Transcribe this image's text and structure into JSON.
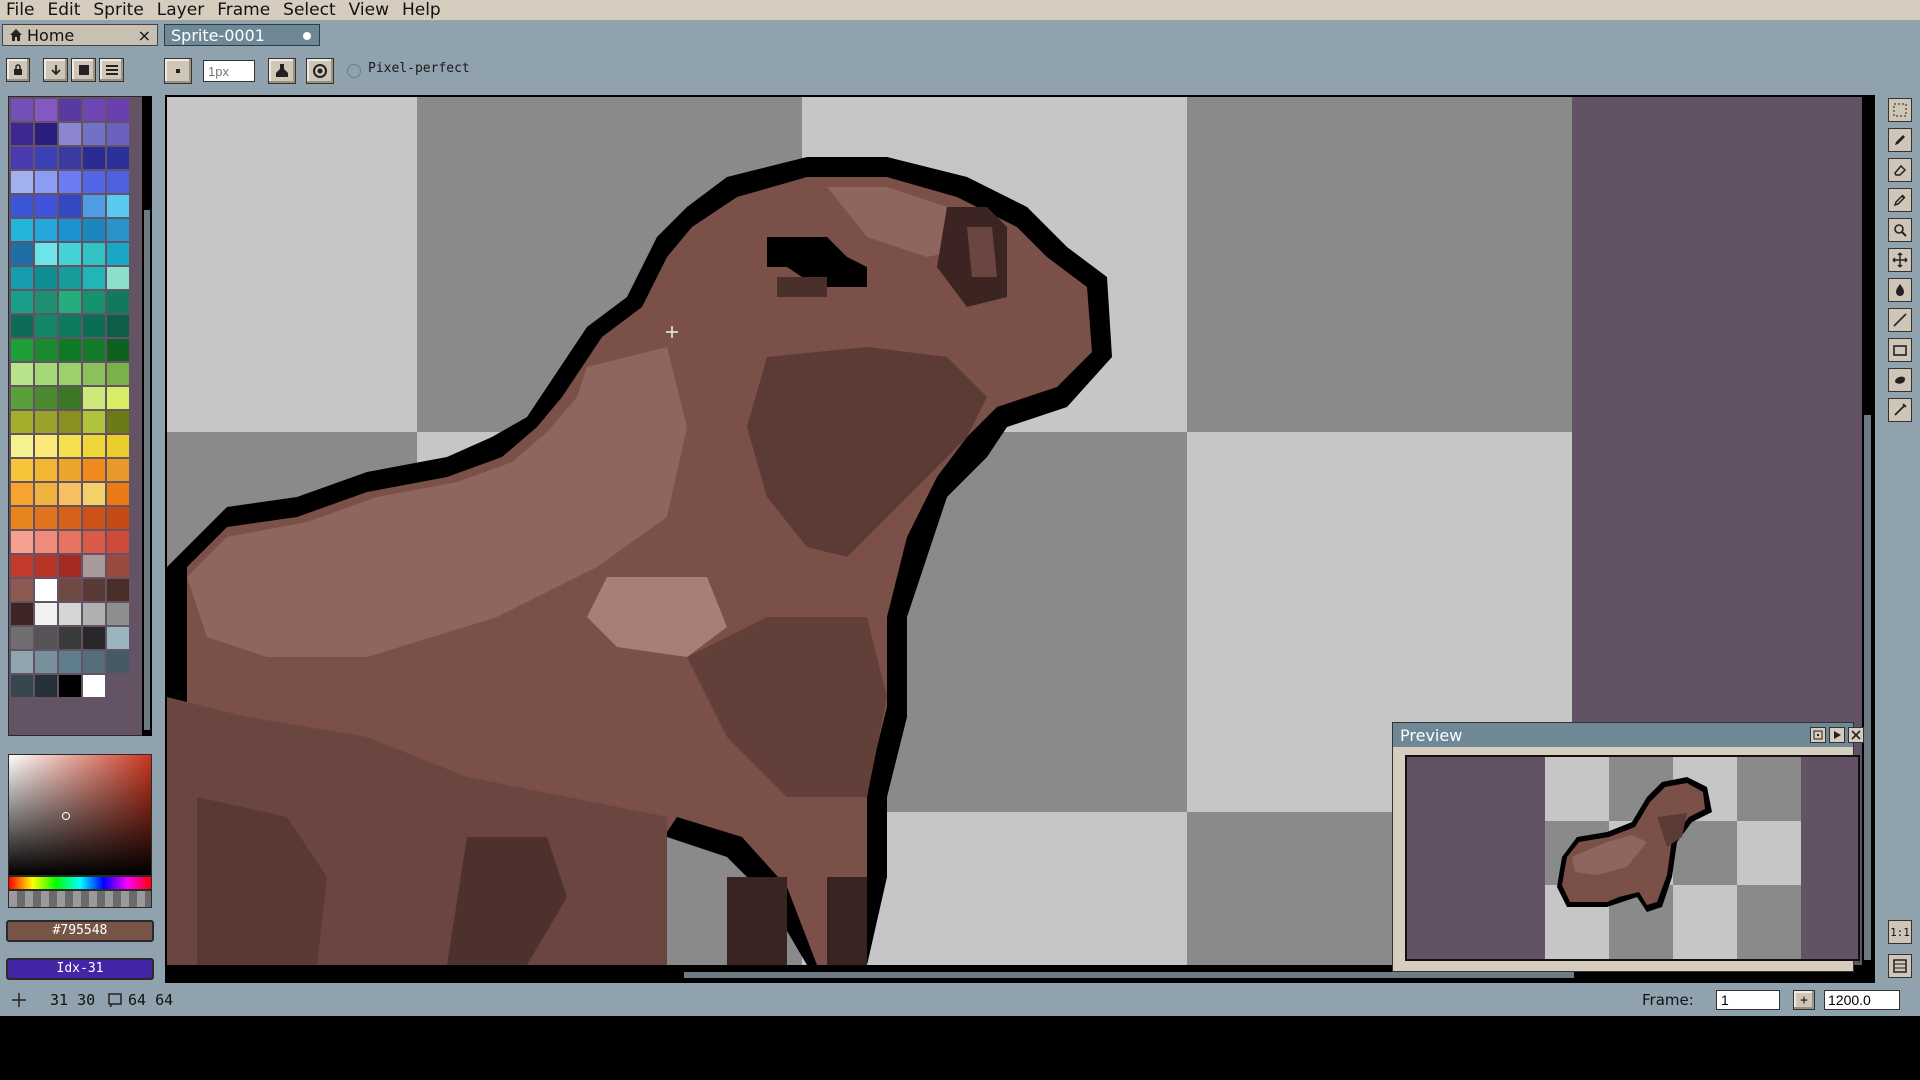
{
  "menu": [
    "File",
    "Edit",
    "Sprite",
    "Layer",
    "Frame",
    "Select",
    "View",
    "Help"
  ],
  "tabs": {
    "home": "Home",
    "home_close": "×",
    "sprite": "Sprite-0001"
  },
  "context": {
    "brush_size_placeholder": "1px",
    "pixel_perfect_label": "Pixel-perfect"
  },
  "color": {
    "hex": "#795548",
    "index": "Idx-31",
    "fg": "#795548",
    "bg": "#ffffff"
  },
  "preview": {
    "title": "Preview"
  },
  "status": {
    "cursor_pos": "31 30",
    "sprite_size": "64 64",
    "frame_label": "Frame:",
    "frame_value": "1",
    "zoom_value": "1200.0",
    "add_frame": "+"
  },
  "tools": [
    "marquee-icon",
    "pencil-icon",
    "eraser-icon",
    "eyedropper-icon",
    "zoom-icon",
    "move-icon",
    "paint-bucket-icon",
    "line-icon",
    "rectangle-icon",
    "contour-icon",
    "blur-icon"
  ],
  "bottom_tools": {
    "actual_size": "1:1",
    "timeline": "timeline-icon"
  },
  "palette": [
    "#7350b6",
    "#8459c4",
    "#5b3a9f",
    "#6e46b3",
    "#6a3fb0",
    "#3d2890",
    "#2a1f7f",
    "#8c86d0",
    "#7171c6",
    "#6d61bf",
    "#4a3ab0",
    "#3a40b5",
    "#3b3ba0",
    "#2b2b96",
    "#2c3099",
    "#a3b0f0",
    "#8b9cf5",
    "#6b7bf2",
    "#5266e6",
    "#4e62e0",
    "#3b55d4",
    "#4153da",
    "#3447c4",
    "#4f9be4",
    "#5ac9f0",
    "#24b6d8",
    "#25a7de",
    "#1c93d0",
    "#1b87be",
    "#2a94c9",
    "#1f6ea6",
    "#6ce4ea",
    "#45d2d6",
    "#32c2c4",
    "#1aa6c5",
    "#169dad",
    "#0e8f93",
    "#1a9b9b",
    "#22b5b5",
    "#8ae0cc",
    "#1d9e8b",
    "#1e8f6f",
    "#27ad7c",
    "#14936c",
    "#117a5e",
    "#0e6b58",
    "#12876a",
    "#0b7c60",
    "#0b6d55",
    "#0e5f4a",
    "#1e9f3a",
    "#1a8a2e",
    "#0f7a26",
    "#137a2a",
    "#0e6120",
    "#b8e28c",
    "#a6d87a",
    "#9cd06a",
    "#8cc05a",
    "#7ab148",
    "#5aa03a",
    "#4a8b30",
    "#3b7826",
    "#cfe87c",
    "#d8ee66",
    "#a4ad2c",
    "#9ba22a",
    "#8b8f20",
    "#b0c33c",
    "#6d7a18",
    "#f3f28f",
    "#fbe97a",
    "#f5e050",
    "#f0d63a",
    "#e8cd2c",
    "#f7c43a",
    "#f2b632",
    "#eaa62a",
    "#f08a1c",
    "#e79a2a",
    "#f7a330",
    "#f0b33e",
    "#f5c062",
    "#f3d06a",
    "#ea7a14",
    "#e8841c",
    "#e0731c",
    "#d6621a",
    "#cc5217",
    "#c44a16",
    "#f5a090",
    "#f08a7a",
    "#e6735f",
    "#da5a4a",
    "#cf4a3b",
    "#c43a2c",
    "#b83526",
    "#a52b20",
    "#a89a9c",
    "#9a4a3e",
    "#8c5a52",
    "#ffffff",
    "#6f4a42",
    "#5a3a34",
    "#4a2e2a",
    "#3c2522",
    "#f1f1f1",
    "#d6d6d6",
    "#b0b0b0",
    "#8e8e8e",
    "#6f6f6f",
    "#545454",
    "#3b3b3b",
    "#282828",
    "#9bb4bf",
    "#90a4ae",
    "#78909c",
    "#607d8b",
    "#546e7a",
    "#455a64",
    "#37474f",
    "#263238",
    "#000000",
    "#ffffff"
  ]
}
